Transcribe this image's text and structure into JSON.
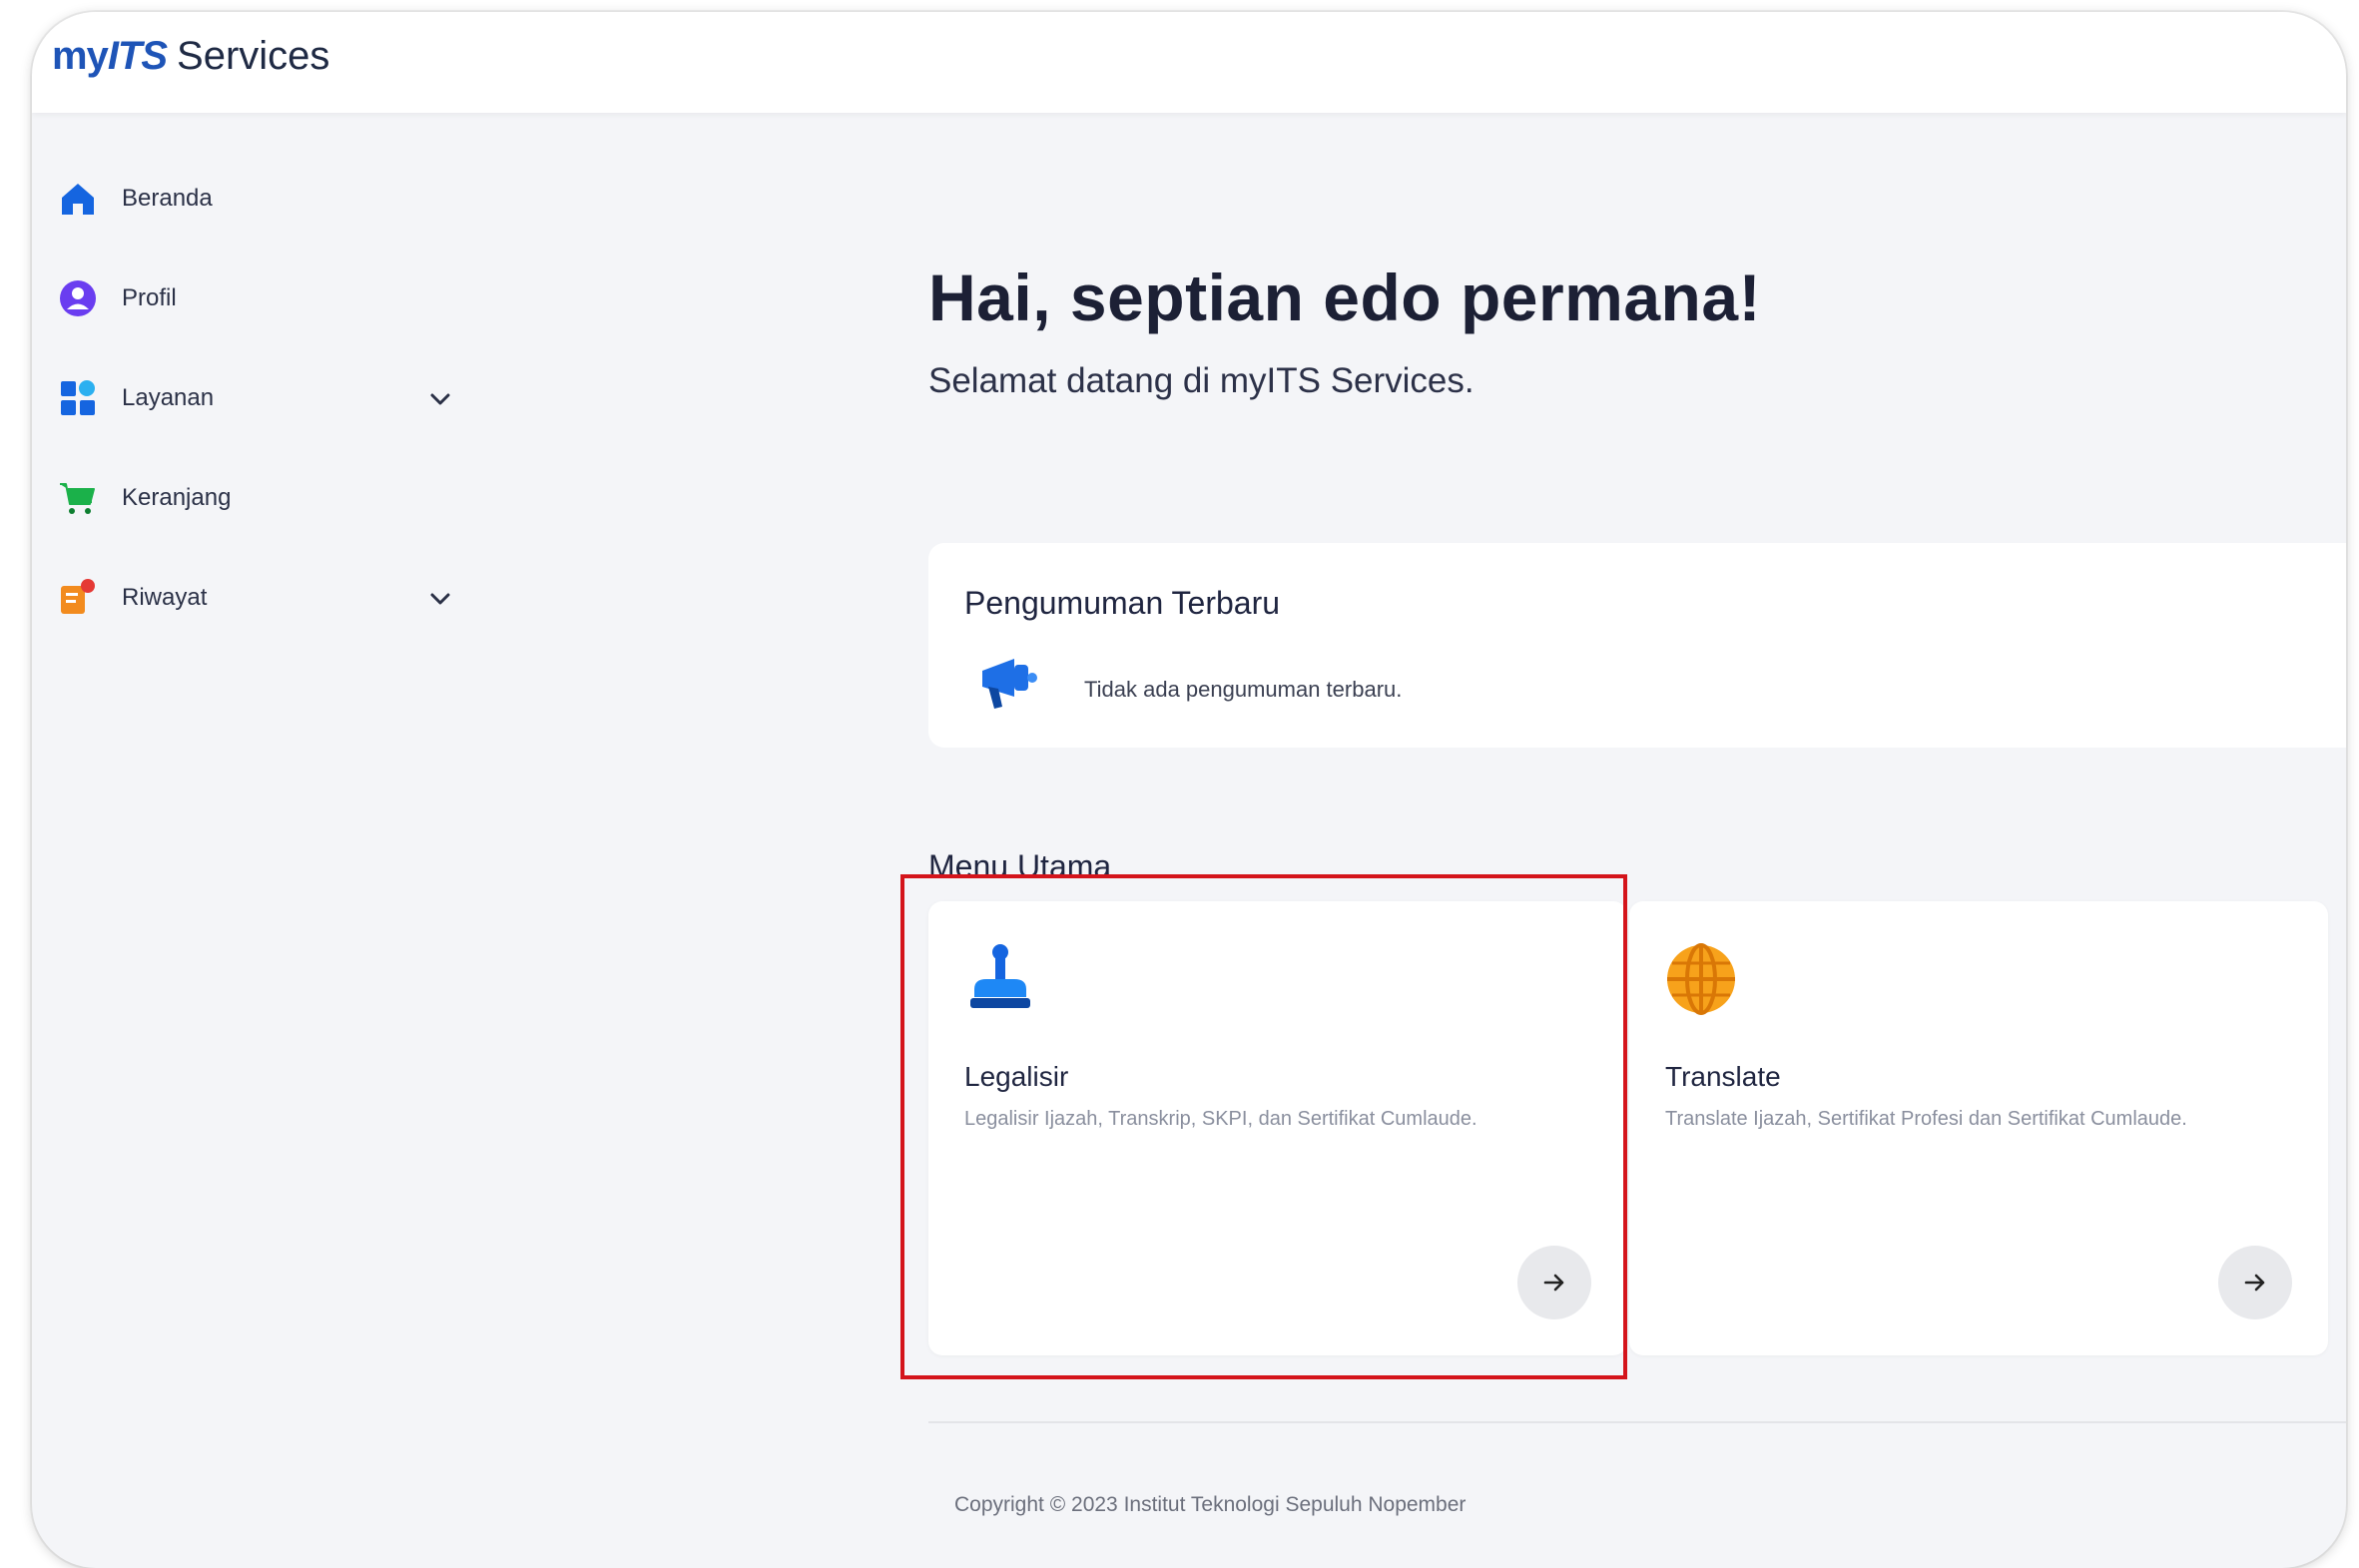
{
  "brand": {
    "my": "my",
    "its": "ITS",
    "services": "Services"
  },
  "sidebar": {
    "items": [
      {
        "label": "Beranda",
        "icon": "home-icon",
        "expandable": false
      },
      {
        "label": "Profil",
        "icon": "profile-icon",
        "expandable": false
      },
      {
        "label": "Layanan",
        "icon": "services-grid-icon",
        "expandable": true
      },
      {
        "label": "Keranjang",
        "icon": "cart-icon",
        "expandable": false
      },
      {
        "label": "Riwayat",
        "icon": "history-icon",
        "expandable": true
      }
    ]
  },
  "hero": {
    "title": "Hai, septian edo permana!",
    "subtitle": "Selamat datang di myITS Services."
  },
  "announcement": {
    "title": "Pengumuman Terbaru",
    "icon": "megaphone-icon",
    "text": "Tidak ada pengumuman terbaru."
  },
  "menu": {
    "title": "Menu Utama",
    "cards": [
      {
        "title": "Legalisir",
        "description": "Legalisir Ijazah, Transkrip, SKPI, dan Sertifikat Cumlaude.",
        "icon": "stamp-icon"
      },
      {
        "title": "Translate",
        "description": "Translate Ijazah, Sertifikat Profesi dan Sertifikat Cumlaude.",
        "icon": "globe-icon"
      }
    ]
  },
  "footer": {
    "copyright": "Copyright © 2023 Institut Teknologi Sepuluh Nopember"
  },
  "colors": {
    "brand_blue": "#1e54b7",
    "highlight": "#d4141b",
    "background": "#f4f5f8",
    "card": "#ffffff"
  }
}
